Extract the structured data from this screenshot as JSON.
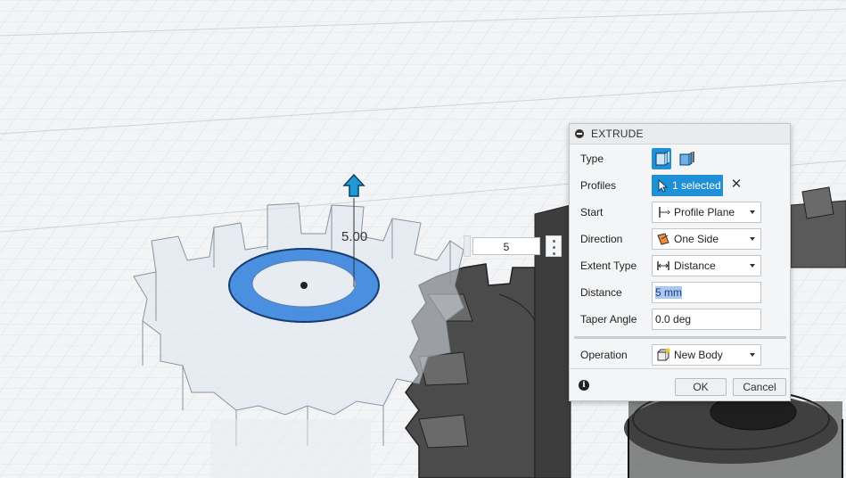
{
  "viewport": {
    "dimension_label": "5.00",
    "distance_input": "5"
  },
  "extrude_dialog": {
    "title": "EXTRUDE",
    "rows": {
      "type": {
        "label": "Type"
      },
      "profiles": {
        "label": "Profiles",
        "value": "1 selected"
      },
      "start": {
        "label": "Start",
        "value": "Profile Plane"
      },
      "direction": {
        "label": "Direction",
        "value": "One Side"
      },
      "extent_type": {
        "label": "Extent Type",
        "value": "Distance"
      },
      "distance": {
        "label": "Distance",
        "value": "5 mm"
      },
      "taper_angle": {
        "label": "Taper Angle",
        "value": "0.0 deg"
      },
      "operation": {
        "label": "Operation",
        "value": "New Body"
      }
    },
    "ok_label": "OK",
    "cancel_label": "Cancel"
  },
  "colors": {
    "accent_blue": "#1f8fd6",
    "profile_ring": "#4a8fe0",
    "selection_highlight": "#a9c9f2"
  }
}
